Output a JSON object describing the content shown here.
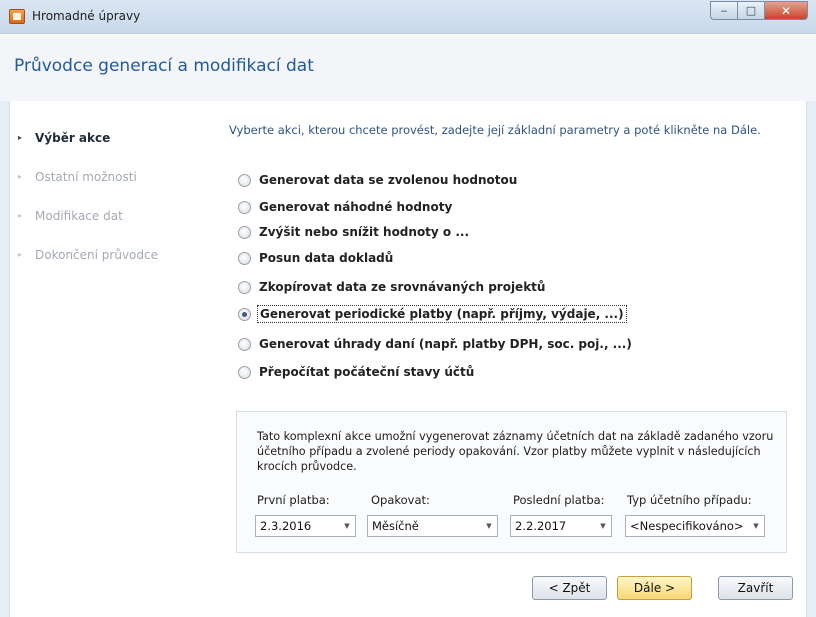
{
  "window": {
    "title": "Hromadné úpravy",
    "controls": [
      "minimize-icon",
      "maximize-icon",
      "close-icon"
    ]
  },
  "header": {
    "title": "Průvodce generací a modifikací dat"
  },
  "steps": [
    {
      "label": "Výběr akce",
      "active": true
    },
    {
      "label": "Ostatní možnosti",
      "active": false
    },
    {
      "label": "Modifikace dat",
      "active": false
    },
    {
      "label": "Dokončení průvodce",
      "active": false
    }
  ],
  "instruction": "Vyberte akci, kterou chcete provést, zadejte její základní parametry a poté klikněte na Dále.",
  "options": [
    {
      "label": "Generovat data se zvolenou hodnotou",
      "selected": false
    },
    {
      "label": "Generovat náhodné hodnoty",
      "selected": false
    },
    {
      "label": "Zvýšit nebo snížit hodnoty o ...",
      "selected": false
    },
    {
      "label": "Posun data dokladů",
      "selected": false
    },
    {
      "label": "Zkopírovat data ze srovnávaných projektů",
      "selected": false
    },
    {
      "label": "Generovat periodické platby (např. příjmy, výdaje, ...)",
      "selected": true
    },
    {
      "label": "Generovat úhrady daní (např. platby DPH, soc. poj., ...)",
      "selected": false
    },
    {
      "label": "Přepočítat počáteční stavy účtů",
      "selected": false
    }
  ],
  "description": "Tato komplexní akce umožní vygenerovat záznamy účetních dat na základě zadaného vzoru účetního případu a zvolené periody opakování. Vzor platby můžete vyplnit v následujících krocích průvodce.",
  "fields": {
    "first_payment": {
      "label": "První platba:",
      "value": "2.3.2016"
    },
    "repeat": {
      "label": "Opakovat:",
      "value": "Měsíčně"
    },
    "last_payment": {
      "label": "Poslední platba:",
      "value": "2.2.2017"
    },
    "case_type": {
      "label": "Typ účetního případu:",
      "value": "<Nespecifikováno>"
    }
  },
  "buttons": {
    "back": "< Zpět",
    "next": "Dále >",
    "close": "Zavřít"
  },
  "colors": {
    "accent": "#1f5a9a",
    "instruction_text": "#2e5380",
    "primary_button": "#f8d774"
  }
}
